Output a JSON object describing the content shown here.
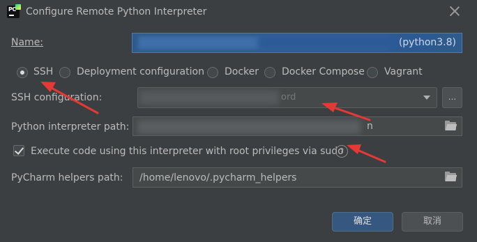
{
  "window": {
    "title": "Configure Remote Python Interpreter"
  },
  "name": {
    "label": "Name:",
    "value": "(python3.8)"
  },
  "types": [
    {
      "label": "SSH",
      "selected": true
    },
    {
      "label": "Deployment configuration",
      "selected": false
    },
    {
      "label": "Docker",
      "selected": false
    },
    {
      "label": "Docker Compose",
      "selected": false
    },
    {
      "label": "Vagrant",
      "selected": false
    }
  ],
  "ssh": {
    "label": "SSH configuration:",
    "value": "ord",
    "browse_label": "..."
  },
  "interpreter": {
    "label": "Python interpreter path:",
    "value": "n"
  },
  "sudo": {
    "label": "Execute code using this interpreter with root privileges via sudo",
    "checked": true,
    "help": "?"
  },
  "helpers": {
    "label": "PyCharm helpers path:",
    "value": "/home/lenovo/.pycharm_helpers"
  },
  "buttons": {
    "ok": "确定",
    "cancel": "取消"
  },
  "colors": {
    "background": "#3c3f41",
    "field": "#45494a",
    "selected_field": "#2e5a8c",
    "annotation_arrow": "#e53935",
    "ok_button": "#365880"
  },
  "icons": [
    "pycharm-app-icon",
    "close-icon",
    "chevron-down-icon",
    "folder-icon",
    "help-icon",
    "annotation-arrow-icon"
  ]
}
